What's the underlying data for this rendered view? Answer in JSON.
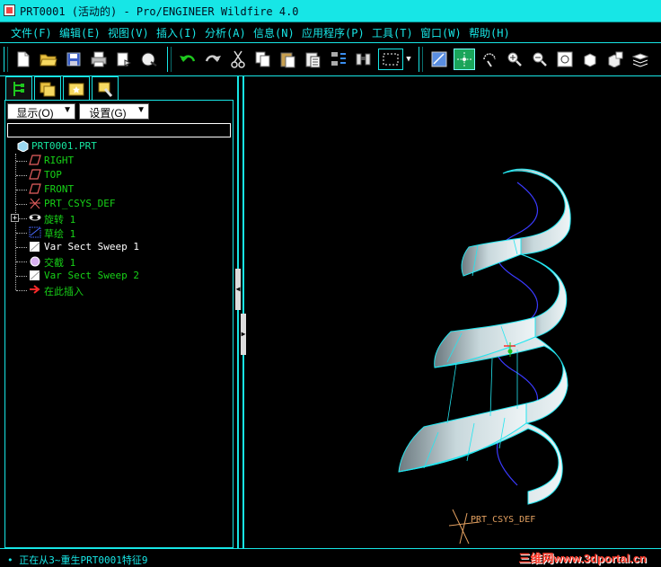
{
  "window": {
    "title": "PRT0001 (活动的) - Pro/ENGINEER Wildfire 4.0"
  },
  "menu": [
    "文件(F)",
    "编辑(E)",
    "视图(V)",
    "插入(I)",
    "分析(A)",
    "信息(N)",
    "应用程序(P)",
    "工具(T)",
    "窗口(W)",
    "帮助(H)"
  ],
  "toolbar": {
    "file_group": [
      "new-icon",
      "open-icon",
      "save-icon",
      "print-icon",
      "send-mail-icon",
      "model-tree-print-icon"
    ],
    "edit_group": [
      "undo-icon",
      "redo-icon",
      "cut-icon",
      "copy-icon",
      "paste-icon",
      "paste-special-icon",
      "regenerate-icon",
      "find-icon",
      "select-box-icon"
    ],
    "view_group": [
      "redraw-icon",
      "spin-center-icon",
      "orient-icon",
      "zoom-in-icon",
      "zoom-out-icon",
      "refit-icon",
      "view-manager-icon",
      "saved-views-icon",
      "layers-icon"
    ]
  },
  "panel": {
    "tabs": [
      "model-tree-icon",
      "folder-browser-icon",
      "favorites-icon",
      "connections-icon"
    ],
    "show_dropdown": "显示(O)",
    "settings_dropdown": "设置(G)",
    "tree": [
      {
        "label": "PRT0001.PRT",
        "icon": "part-icon",
        "color": "#17e6a0",
        "indent": 0
      },
      {
        "label": "RIGHT",
        "icon": "datum-plane-icon",
        "color": "#17d217",
        "indent": 1
      },
      {
        "label": "TOP",
        "icon": "datum-plane-icon",
        "color": "#17d217",
        "indent": 1
      },
      {
        "label": "FRONT",
        "icon": "datum-plane-icon",
        "color": "#17d217",
        "indent": 1
      },
      {
        "label": "PRT_CSYS_DEF",
        "icon": "coordinate-system-icon",
        "color": "#17d217",
        "indent": 1
      },
      {
        "label": "旋转 1",
        "icon": "revolve-icon",
        "color": "#17d217",
        "indent": 1,
        "expandable": true
      },
      {
        "label": "草绘 1",
        "icon": "sketch-icon",
        "color": "#17d217",
        "indent": 1
      },
      {
        "label": "Var Sect Sweep 1",
        "icon": "var-sect-sweep-icon",
        "color": "#ffffff",
        "indent": 1
      },
      {
        "label": "交截 1",
        "icon": "intersect-icon",
        "color": "#17d217",
        "indent": 1
      },
      {
        "label": "Var Sect Sweep 2",
        "icon": "var-sect-sweep-icon",
        "color": "#17d217",
        "indent": 1
      },
      {
        "label": "在此插入",
        "icon": "insert-here-arrow-icon",
        "color": "#17d217",
        "indent": 1
      }
    ]
  },
  "graphics": {
    "csys_label": "PRT_CSYS_DEF"
  },
  "status": {
    "message": "• 正在从3~重生PRT0001特征9",
    "watermark": "三维网www.3dportal.cn"
  },
  "colors": {
    "accent": "#17e6e6",
    "surface": "#c8d8dc",
    "edge": "#23e6f0",
    "curve": "#3a3aff",
    "tree_green": "#17d217"
  }
}
